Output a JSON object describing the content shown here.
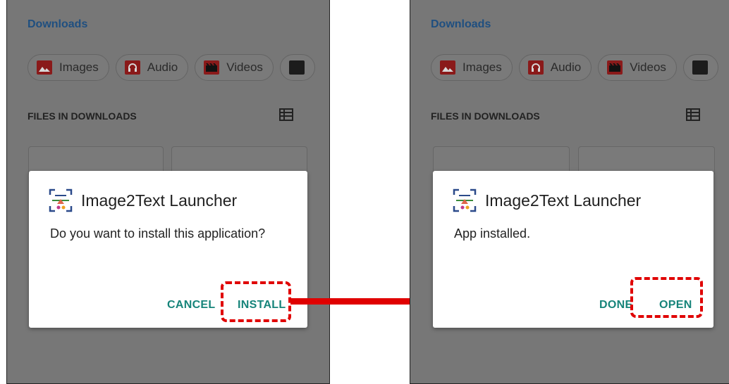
{
  "left_screen": {
    "header_title": "Downloads",
    "chips": [
      "Images",
      "Audio",
      "Videos"
    ],
    "files_header": "FILES IN DOWNLOADS",
    "dialog": {
      "app_name": "Image2Text Launcher",
      "message": "Do you want to install this application?",
      "cancel_label": "CANCEL",
      "install_label": "INSTALL"
    }
  },
  "right_screen": {
    "header_title": "Downloads",
    "chips": [
      "Images",
      "Audio",
      "Videos"
    ],
    "files_header": "FILES IN DOWNLOADS",
    "dialog": {
      "app_name": "Image2Text Launcher",
      "message": "App installed.",
      "done_label": "DONE",
      "open_label": "OPEN"
    }
  },
  "colors": {
    "accent": "#16847a",
    "highlight": "#e00000",
    "header_link": "#1f4f80",
    "scrim": "#777777"
  },
  "icons": [
    "image-icon",
    "headphones-icon",
    "video-icon",
    "document-icon",
    "list-view-icon",
    "app-icon"
  ]
}
